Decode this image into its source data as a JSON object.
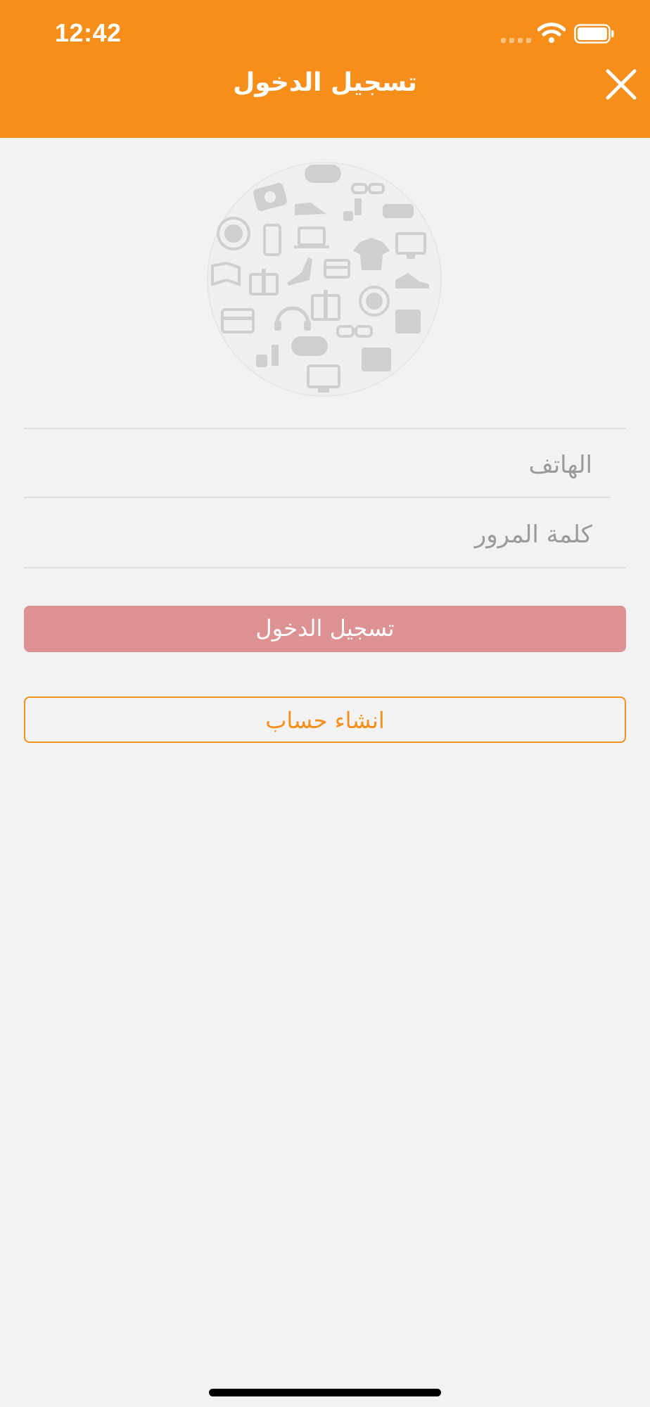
{
  "status_bar": {
    "time": "12:42"
  },
  "header": {
    "title": "تسجيل الدخول"
  },
  "form": {
    "phone_placeholder": "الهاتف",
    "phone_value": "",
    "password_placeholder": "كلمة المرور",
    "password_value": ""
  },
  "buttons": {
    "login_label": "تسجيل الدخول",
    "register_label": "انشاء حساب"
  },
  "icons": {
    "close": "close-icon",
    "logo": "shopping-categories-logo"
  },
  "colors": {
    "brand_orange": "#f58e1a",
    "background": "#f2f2f2",
    "login_button": "#dc9292",
    "placeholder": "#9a9a9a"
  }
}
